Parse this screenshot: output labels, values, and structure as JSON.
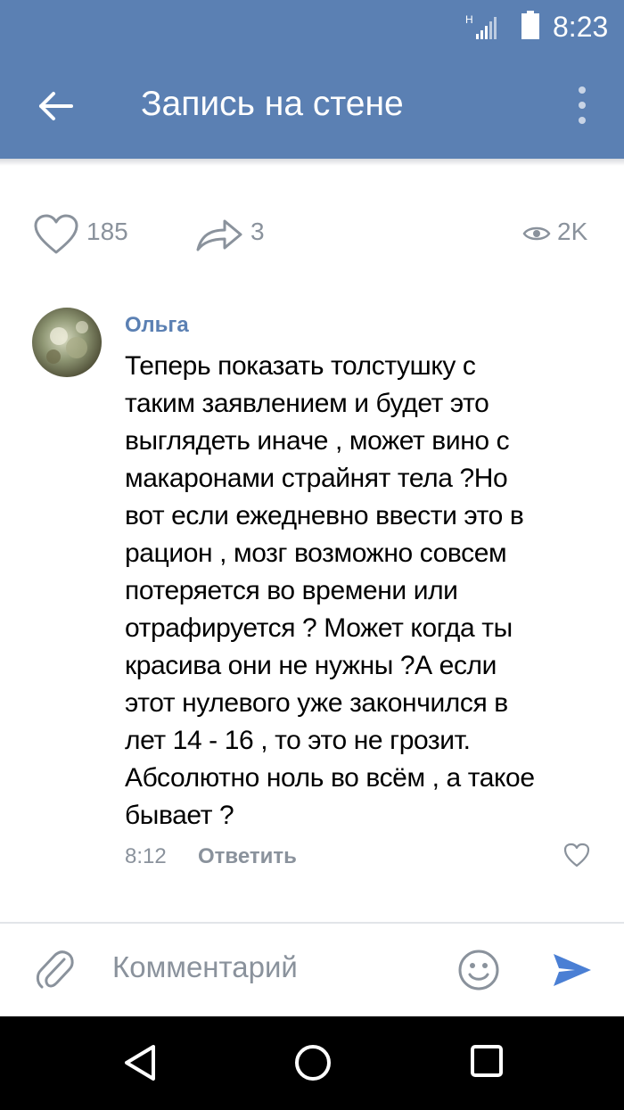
{
  "status_bar": {
    "signal_label": "H",
    "time": "8:23",
    "colors": {
      "background": "#5b80b3"
    }
  },
  "app_bar": {
    "title": "Запись на стене",
    "back_icon": "arrow-left-icon",
    "menu_icon": "more-vertical-icon"
  },
  "post_stats": {
    "likes": "185",
    "shares": "3",
    "views": "2K"
  },
  "comment": {
    "author": "Ольга",
    "lines": [
      "Теперь показать толстушку с",
      "таким заявлением и будет это",
      "выглядеть иначе , может вино с",
      "макаронами страйнят тела ?Но",
      "вот если ежедневно ввести это в",
      "рацион , мозг возможно совсем",
      "потеряется во времени или",
      "отрафируется ? Может когда ты",
      "красива они не нужны ?А если",
      "этот нулевого уже закончился в",
      "лет 14 - 16 , то это не грозит.",
      "Абсолютно ноль во всём , а такое",
      "бывает ?"
    ],
    "time": "8:12",
    "reply_label": "Ответить"
  },
  "composer": {
    "placeholder": "Комментарий"
  },
  "nav_bar": {
    "back_icon": "triangle-back-icon",
    "home_icon": "circle-home-icon",
    "recent_icon": "square-recent-icon"
  },
  "theme": {
    "accent": "#5b80b3",
    "muted": "#8a929c",
    "send": "#4a7fd4"
  }
}
